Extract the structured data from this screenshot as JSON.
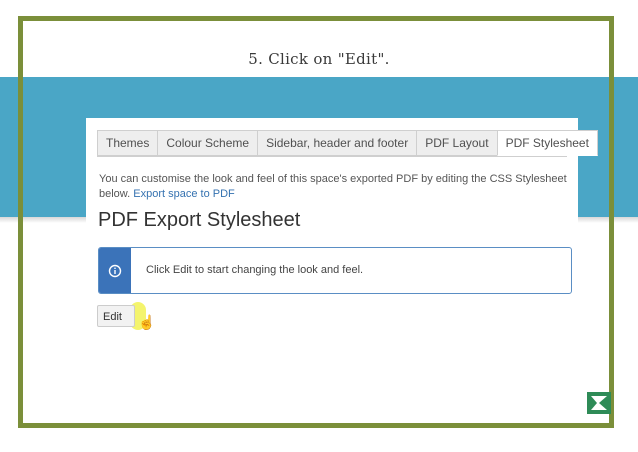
{
  "caption": "5. Click on \"Edit\".",
  "tabs": [
    {
      "label": "Themes",
      "active": false
    },
    {
      "label": "Colour Scheme",
      "active": false
    },
    {
      "label": "Sidebar, header and footer",
      "active": false
    },
    {
      "label": "PDF Layout",
      "active": false
    },
    {
      "label": "PDF Stylesheet",
      "active": true
    }
  ],
  "description": {
    "text": "You can customise the look and feel of this space's exported PDF by editing the CSS Stylesheet below.",
    "link": "Export space to PDF"
  },
  "heading": "PDF Export Stylesheet",
  "info": {
    "message": "Click Edit to start changing the look and feel.",
    "icon": "info-icon"
  },
  "edit_button": {
    "label": "Edit"
  },
  "colors": {
    "frame": "#7b8f3a",
    "band": "#4aa6c6",
    "info_accent": "#3b73b9",
    "link": "#3572b0"
  }
}
